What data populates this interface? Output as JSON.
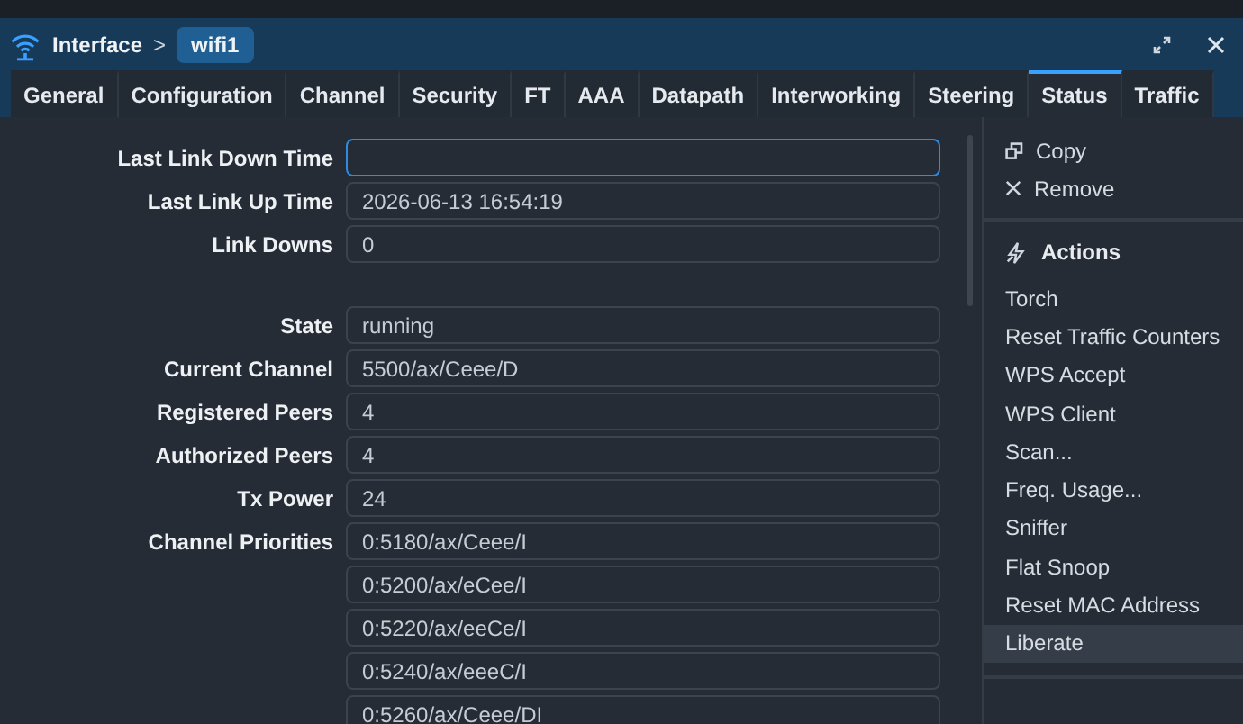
{
  "window": {
    "breadcrumb": "Interface",
    "separator": ">",
    "title": "wifi1"
  },
  "tabs": [
    {
      "label": "General",
      "selected": false
    },
    {
      "label": "Configuration",
      "selected": false
    },
    {
      "label": "Channel",
      "selected": false
    },
    {
      "label": "Security",
      "selected": false
    },
    {
      "label": "FT",
      "selected": false
    },
    {
      "label": "AAA",
      "selected": false
    },
    {
      "label": "Datapath",
      "selected": false
    },
    {
      "label": "Interworking",
      "selected": false
    },
    {
      "label": "Steering",
      "selected": false
    },
    {
      "label": "Status",
      "selected": true
    },
    {
      "label": "Traffic",
      "selected": false
    }
  ],
  "fields": [
    {
      "kind": "field",
      "label": "Last Link Down Time",
      "focused": true
    },
    {
      "kind": "field",
      "label": "Last Link Up Time",
      "values": [
        "2026-06-13 16:54:19"
      ],
      "focused": false
    },
    {
      "kind": "field",
      "label": "Link Downs",
      "values": [
        "0"
      ],
      "focused": false
    },
    {
      "kind": "divider"
    },
    {
      "kind": "field",
      "label": "State",
      "values": [
        "running"
      ],
      "focused": false
    },
    {
      "kind": "field",
      "label": "Current Channel",
      "values": [
        "5500/ax/Ceee/D"
      ],
      "focused": false
    },
    {
      "kind": "field",
      "label": "Registered Peers",
      "values": [
        "4"
      ],
      "focused": false
    },
    {
      "kind": "field",
      "label": "Authorized Peers",
      "values": [
        "4"
      ],
      "focused": false
    },
    {
      "kind": "field",
      "label": "Tx Power",
      "values": [
        "24"
      ],
      "focused": false
    },
    {
      "kind": "field",
      "label": "Channel Priorities",
      "values": [
        "0:5180/ax/Ceee/I",
        "0:5200/ax/eCee/I",
        "0:5220/ax/eeCe/I",
        "0:5240/ax/eeeC/I",
        "0:5260/ax/Ceee/DI"
      ],
      "focused": false
    }
  ],
  "side_panel": {
    "commands": [
      {
        "kind": "copy",
        "label": "Copy"
      },
      {
        "kind": "remove",
        "label": "Remove"
      }
    ],
    "actions_title": "Actions",
    "actions": [
      {
        "label": "Torch",
        "selected": false
      },
      {
        "label": "Reset Traffic Counters",
        "selected": false
      },
      {
        "label": "WPS Accept",
        "selected": false
      },
      {
        "label": "WPS Client",
        "selected": false
      },
      {
        "label": "Scan...",
        "selected": false
      },
      {
        "label": "Freq. Usage...",
        "selected": false
      },
      {
        "label": "Sniffer",
        "selected": false
      },
      {
        "label": "Flat Snoop",
        "selected": false
      },
      {
        "label": "Reset MAC Address",
        "selected": false
      },
      {
        "label": "Liberate",
        "selected": true
      }
    ]
  }
}
